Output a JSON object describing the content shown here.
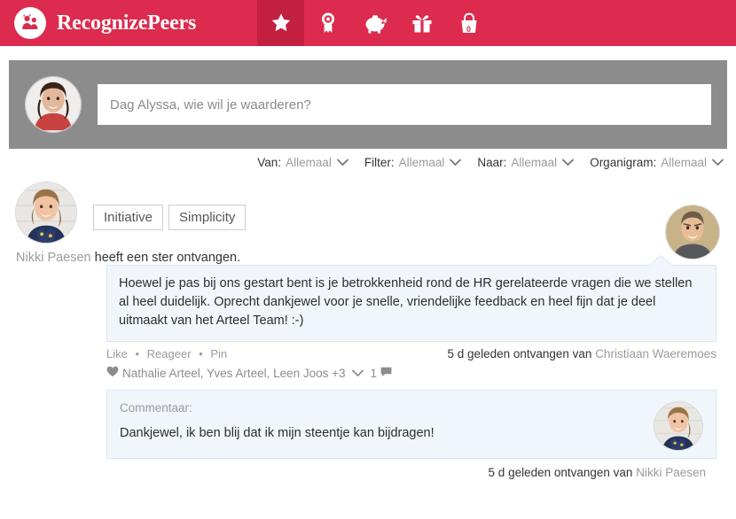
{
  "brand": {
    "name": "RecognizePeers",
    "logo_icon": "people-badge-icon",
    "color": "#DC2B4E"
  },
  "nav": {
    "active_index": 0,
    "items": [
      {
        "icon": "star-icon",
        "label": "Recognitions",
        "active": true
      },
      {
        "icon": "award-ribbon-icon",
        "label": "Awards",
        "active": false
      },
      {
        "icon": "piggy-bank-icon",
        "label": "Savings",
        "active": false
      },
      {
        "icon": "gift-icon",
        "label": "Rewards",
        "active": false
      },
      {
        "icon": "shopping-bag-icon",
        "label": "Cart",
        "active": false,
        "count": "0"
      }
    ]
  },
  "compose": {
    "avatar_name": "alyssa-avatar",
    "placeholder": "Dag Alyssa, wie wil je waarderen?",
    "value": "",
    "band_color": "#8C8C8C"
  },
  "filters": [
    {
      "label": "Van:",
      "value": "Allemaal",
      "name": "filter-van"
    },
    {
      "label": "Filter:",
      "value": "Allemaal",
      "name": "filter-filter"
    },
    {
      "label": "Naar:",
      "value": "Allemaal",
      "name": "filter-naar"
    },
    {
      "label": "Organigram:",
      "value": "Allemaal",
      "name": "filter-organigram"
    }
  ],
  "post": {
    "recipient_avatar_name": "nikki-paesen-avatar",
    "giver_avatar_name": "christiaan-waeremoes-avatar",
    "badges": [
      "Initiative",
      "Simplicity"
    ],
    "recipient_name": "Nikki Paesen",
    "recipient_action": "heeft een ster ontvangen.",
    "message": "Hoewel je pas bij ons gestart bent is je betrokkenheid rond de HR gerelateerde vragen die we stellen al heel duidelijk. Oprecht dankjewel voor je snelle, vriendelijke feedback en heel fijn dat je deel uitmaakt van het Arteel Team! :-)",
    "actions": {
      "like": "Like",
      "comment": "Reageer",
      "pin": "Pin",
      "separator": "•"
    },
    "received_prefix": "5 d geleden ontvangen van",
    "received_from": "Christiaan Waeremoes",
    "likes": {
      "heart_icon": "heart-icon",
      "names": "Nathalie Arteel, Yves Arteel, Leen Joos +3",
      "caret_icon": "chevron-down-icon",
      "comment_count": "1",
      "comment_icon": "comment-bubble-icon"
    },
    "comment": {
      "label": "Commentaar:",
      "text": "Dankjewel, ik ben blij dat ik mijn steentje kan bijdragen!",
      "avatar_name": "nikki-paesen-avatar",
      "received_prefix": "5 d geleden ontvangen van",
      "received_from": "Nikki Paesen"
    }
  },
  "colors": {
    "brand_red": "#DC2B4E",
    "brand_red_dark": "#C4203F",
    "band_gray": "#8C8C8C",
    "bubble_blue": "#F0F6FB"
  }
}
